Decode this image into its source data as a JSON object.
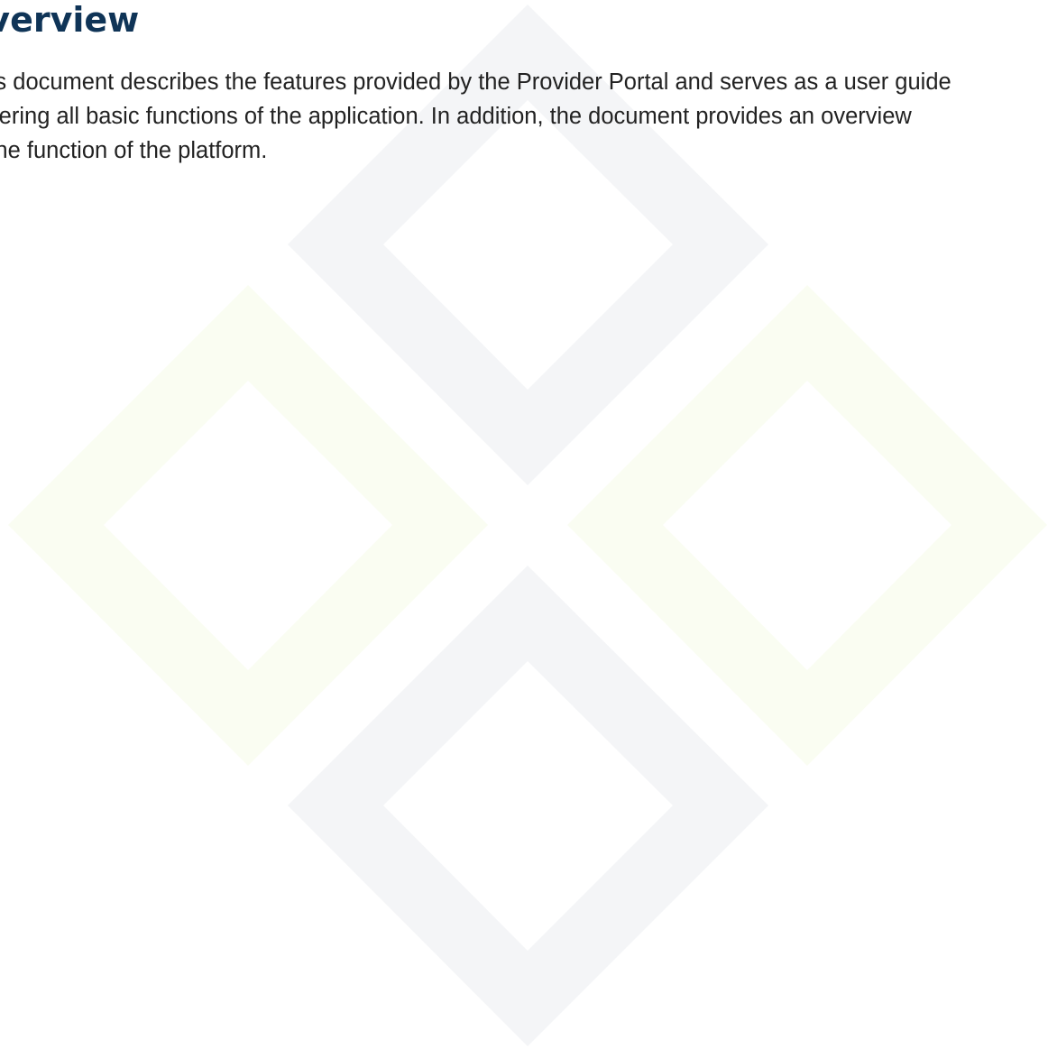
{
  "page": {
    "title": "Overview",
    "intro_lines": [
      "This document describes the features provided by the Provider Portal and serves as a user guide",
      "covering all basic functions of the application. In addition, the document provides an overview",
      "of the function of the platform."
    ]
  },
  "watermark": {
    "icon": "four-diamond-watermark-icon",
    "colors": {
      "grey": "#f4f5f7",
      "green": "#fafdf2"
    }
  }
}
